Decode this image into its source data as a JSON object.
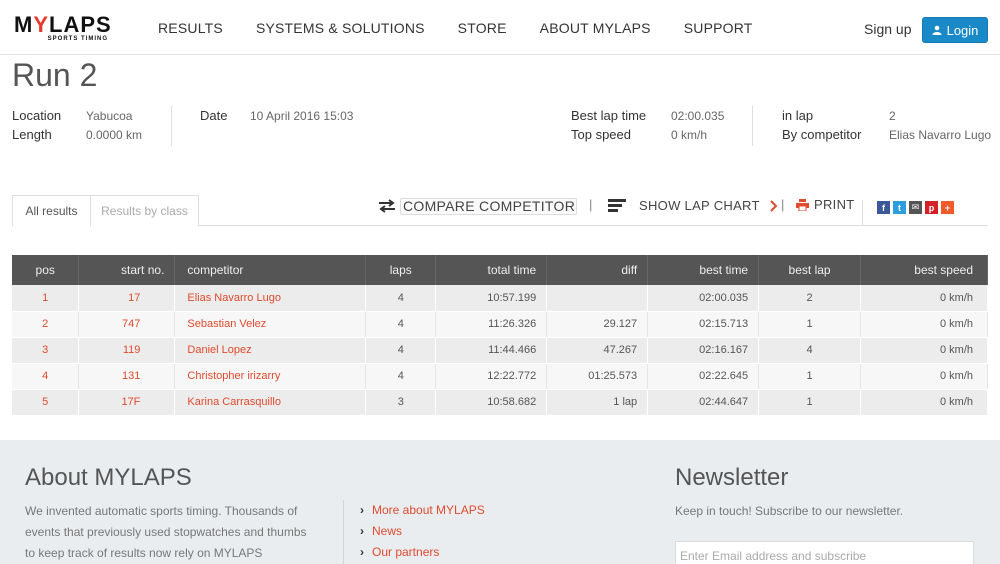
{
  "header": {
    "logo_main_a": "M",
    "logo_main_y": "Y",
    "logo_main_b": "LAPS",
    "logo_sub": "SPORTS TIMING",
    "nav": [
      "RESULTS",
      "SYSTEMS & SOLUTIONS",
      "STORE",
      "ABOUT MYLAPS",
      "SUPPORT"
    ],
    "signup": "Sign up",
    "login": "Login"
  },
  "event": {
    "title": "Run 2",
    "location_label": "Location",
    "location": "Yabucoa",
    "length_label": "Length",
    "length": "0.0000 km",
    "date_label": "Date",
    "date": "10 April 2016 15:03",
    "best_lap_label": "Best lap time",
    "best_lap": "02:00.035",
    "top_speed_label": "Top speed",
    "top_speed": "0 km/h",
    "in_lap_label": "in lap",
    "in_lap": "2",
    "by_competitor_label": "By competitor",
    "by_competitor": "Elias Navarro Lugo"
  },
  "tabs": {
    "all": "All results",
    "by_class": "Results by class"
  },
  "toolbar": {
    "compare": "COMPARE COMPETITOR",
    "sep": "|",
    "lap_chart": "SHOW LAP CHART",
    "print": "PRINT"
  },
  "social": [
    {
      "icon": "facebook-icon",
      "glyph": "f",
      "color": "#3b5998"
    },
    {
      "icon": "twitter-icon",
      "glyph": "t",
      "color": "#2d9de2"
    },
    {
      "icon": "email-icon",
      "glyph": "✉",
      "color": "#555555"
    },
    {
      "icon": "pinterest-icon",
      "glyph": "p",
      "color": "#d42127"
    },
    {
      "icon": "plus-icon",
      "glyph": "+",
      "color": "#f15a29"
    }
  ],
  "table": {
    "headers": [
      "pos",
      "start no.",
      "competitor",
      "laps",
      "total time",
      "diff",
      "best time",
      "best lap",
      "best speed"
    ],
    "rows": [
      [
        "1",
        "17",
        "Elias Navarro Lugo",
        "4",
        "10:57.199",
        "",
        "02:00.035",
        "2",
        "0 km/h"
      ],
      [
        "2",
        "747",
        "Sebastian Velez",
        "4",
        "11:26.326",
        "29.127",
        "02:15.713",
        "1",
        "0 km/h"
      ],
      [
        "3",
        "119",
        "Daniel Lopez",
        "4",
        "11:44.466",
        "47.267",
        "02:16.167",
        "4",
        "0 km/h"
      ],
      [
        "4",
        "131",
        "Christopher irizarry",
        "4",
        "12:22.772",
        "01:25.573",
        "02:22.645",
        "1",
        "0 km/h"
      ],
      [
        "5",
        "17F",
        "Karina Carrasquillo",
        "3",
        "10:58.682",
        "1 lap",
        "02:44.647",
        "1",
        "0 km/h"
      ]
    ]
  },
  "footer": {
    "about_title": "About MYLAPS",
    "about_text_1": "We invented automatic sports timing. Thousands of",
    "about_text_2": "events that previously used stopwatches and thumbs",
    "about_text_3": "to keep track of results now rely on MYLAPS",
    "links": [
      "More about MYLAPS",
      "News",
      "Our partners"
    ],
    "newsletter_title": "Newsletter",
    "newsletter_text": "Keep in touch! Subscribe to our newsletter.",
    "email_placeholder": "Enter Email address and subscribe"
  }
}
